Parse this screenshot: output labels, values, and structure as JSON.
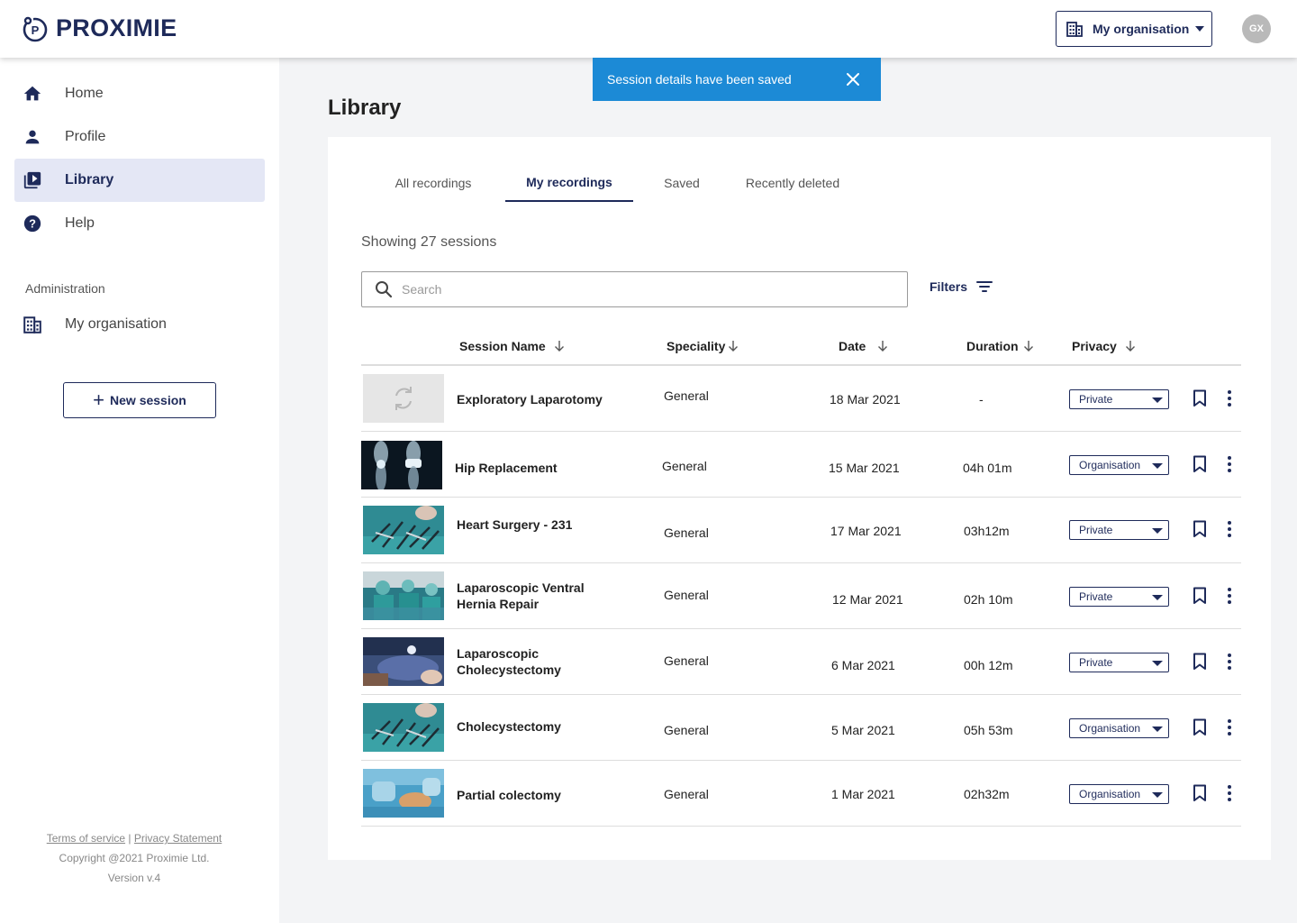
{
  "header": {
    "brand": "PROXIMIE",
    "org_select_label": "My organisation",
    "avatar_initials": "GX"
  },
  "sidebar": {
    "items": [
      {
        "label": "Home",
        "icon": "home-icon"
      },
      {
        "label": "Profile",
        "icon": "person-icon"
      },
      {
        "label": "Library",
        "icon": "library-icon",
        "active": true
      },
      {
        "label": "Help",
        "icon": "help-icon"
      }
    ],
    "admin_label": "Administration",
    "admin_items": [
      {
        "label": "My organisation",
        "icon": "building-icon"
      }
    ],
    "new_session_label": "New session",
    "footer": {
      "terms": "Terms of service",
      "separator": "|",
      "privacy": "Privacy Statement",
      "copyright": "Copyright @2021 Proximie Ltd.",
      "version": "Version v.4"
    }
  },
  "toast": {
    "message": "Session details have been saved"
  },
  "main": {
    "title": "Library",
    "tabs": [
      {
        "label": "All recordings"
      },
      {
        "label": "My recordings",
        "active": true
      },
      {
        "label": "Saved"
      },
      {
        "label": "Recently deleted"
      }
    ],
    "showing": "Showing 27 sessions",
    "search_placeholder": "Search",
    "filters_label": "Filters",
    "columns": {
      "name": "Session Name",
      "speciality": "Speciality",
      "date": "Date",
      "duration": "Duration",
      "privacy": "Privacy"
    },
    "rows": [
      {
        "name": "Exploratory Laparotomy",
        "speciality": "General",
        "date": "18 Mar 2021",
        "duration": "-",
        "privacy": "Private",
        "thumb": "processing"
      },
      {
        "name": "Hip Replacement",
        "speciality": "General",
        "date": "15 Mar 2021",
        "duration": "04h 01m",
        "privacy": "Organisation",
        "thumb": "xray"
      },
      {
        "name": "Heart Surgery - 231",
        "speciality": "General",
        "date": "17 Mar 2021",
        "duration": "03h12m",
        "privacy": "Private",
        "thumb": "instruments"
      },
      {
        "name": "Laparoscopic Ventral Hernia Repair",
        "speciality": "General",
        "date": "12 Mar 2021",
        "duration": "02h 10m",
        "privacy": "Private",
        "thumb": "surgeons"
      },
      {
        "name": "Laparoscopic Cholecystectomy",
        "speciality": "General",
        "date": "6 Mar 2021",
        "duration": "00h 12m",
        "privacy": "Private",
        "thumb": "patient"
      },
      {
        "name": "Cholecystectomy",
        "speciality": "General",
        "date": "5 Mar 2021",
        "duration": "05h 53m",
        "privacy": "Organisation",
        "thumb": "instruments"
      },
      {
        "name": "Partial colectomy",
        "speciality": "General",
        "date": "1 Mar 2021",
        "duration": "02h32m",
        "privacy": "Organisation",
        "thumb": "operation"
      }
    ]
  },
  "colors": {
    "brand_navy": "#1e2a5a",
    "toast_blue": "#1c8ad6",
    "active_nav_bg": "#e4e7f5"
  }
}
